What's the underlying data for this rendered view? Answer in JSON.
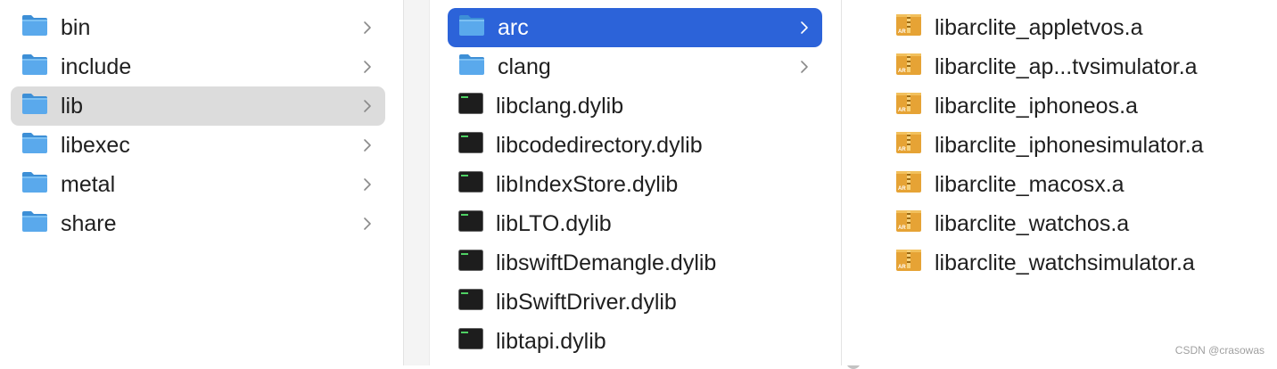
{
  "columns": {
    "first": {
      "items": [
        {
          "label": "bin",
          "icon": "folder-icon",
          "has_children": true
        },
        {
          "label": "include",
          "icon": "folder-icon",
          "has_children": true
        },
        {
          "label": "lib",
          "icon": "folder-icon",
          "has_children": true,
          "selected": "inactive"
        },
        {
          "label": "libexec",
          "icon": "folder-icon",
          "has_children": true
        },
        {
          "label": "metal",
          "icon": "folder-icon",
          "has_children": true
        },
        {
          "label": "share",
          "icon": "folder-icon",
          "has_children": true
        }
      ]
    },
    "second": {
      "items": [
        {
          "label": "arc",
          "icon": "folder-icon",
          "has_children": true,
          "selected": "active"
        },
        {
          "label": "clang",
          "icon": "folder-icon",
          "has_children": true
        },
        {
          "label": "libclang.dylib",
          "icon": "executable-icon"
        },
        {
          "label": "libcodedirectory.dylib",
          "icon": "executable-icon"
        },
        {
          "label": "libIndexStore.dylib",
          "icon": "executable-icon"
        },
        {
          "label": "libLTO.dylib",
          "icon": "executable-icon"
        },
        {
          "label": "libswiftDemangle.dylib",
          "icon": "executable-icon"
        },
        {
          "label": "libSwiftDriver.dylib",
          "icon": "executable-icon"
        },
        {
          "label": "libtapi.dylib",
          "icon": "executable-icon"
        }
      ]
    },
    "third": {
      "items": [
        {
          "label": "libarclite_appletvos.a",
          "icon": "archive-icon"
        },
        {
          "label": "libarclite_ap...tvsimulator.a",
          "icon": "archive-icon"
        },
        {
          "label": "libarclite_iphoneos.a",
          "icon": "archive-icon"
        },
        {
          "label": "libarclite_iphonesimulator.a",
          "icon": "archive-icon"
        },
        {
          "label": "libarclite_macosx.a",
          "icon": "archive-icon"
        },
        {
          "label": "libarclite_watchos.a",
          "icon": "archive-icon"
        },
        {
          "label": "libarclite_watchsimulator.a",
          "icon": "archive-icon"
        }
      ]
    }
  },
  "archive_badge": "AR",
  "watermark": "CSDN @crasowas",
  "colors": {
    "selection_active": "#2c63d9",
    "selection_inactive": "#dcdcdc",
    "folder": "#5aa9ec",
    "archive": "#e6a335"
  }
}
